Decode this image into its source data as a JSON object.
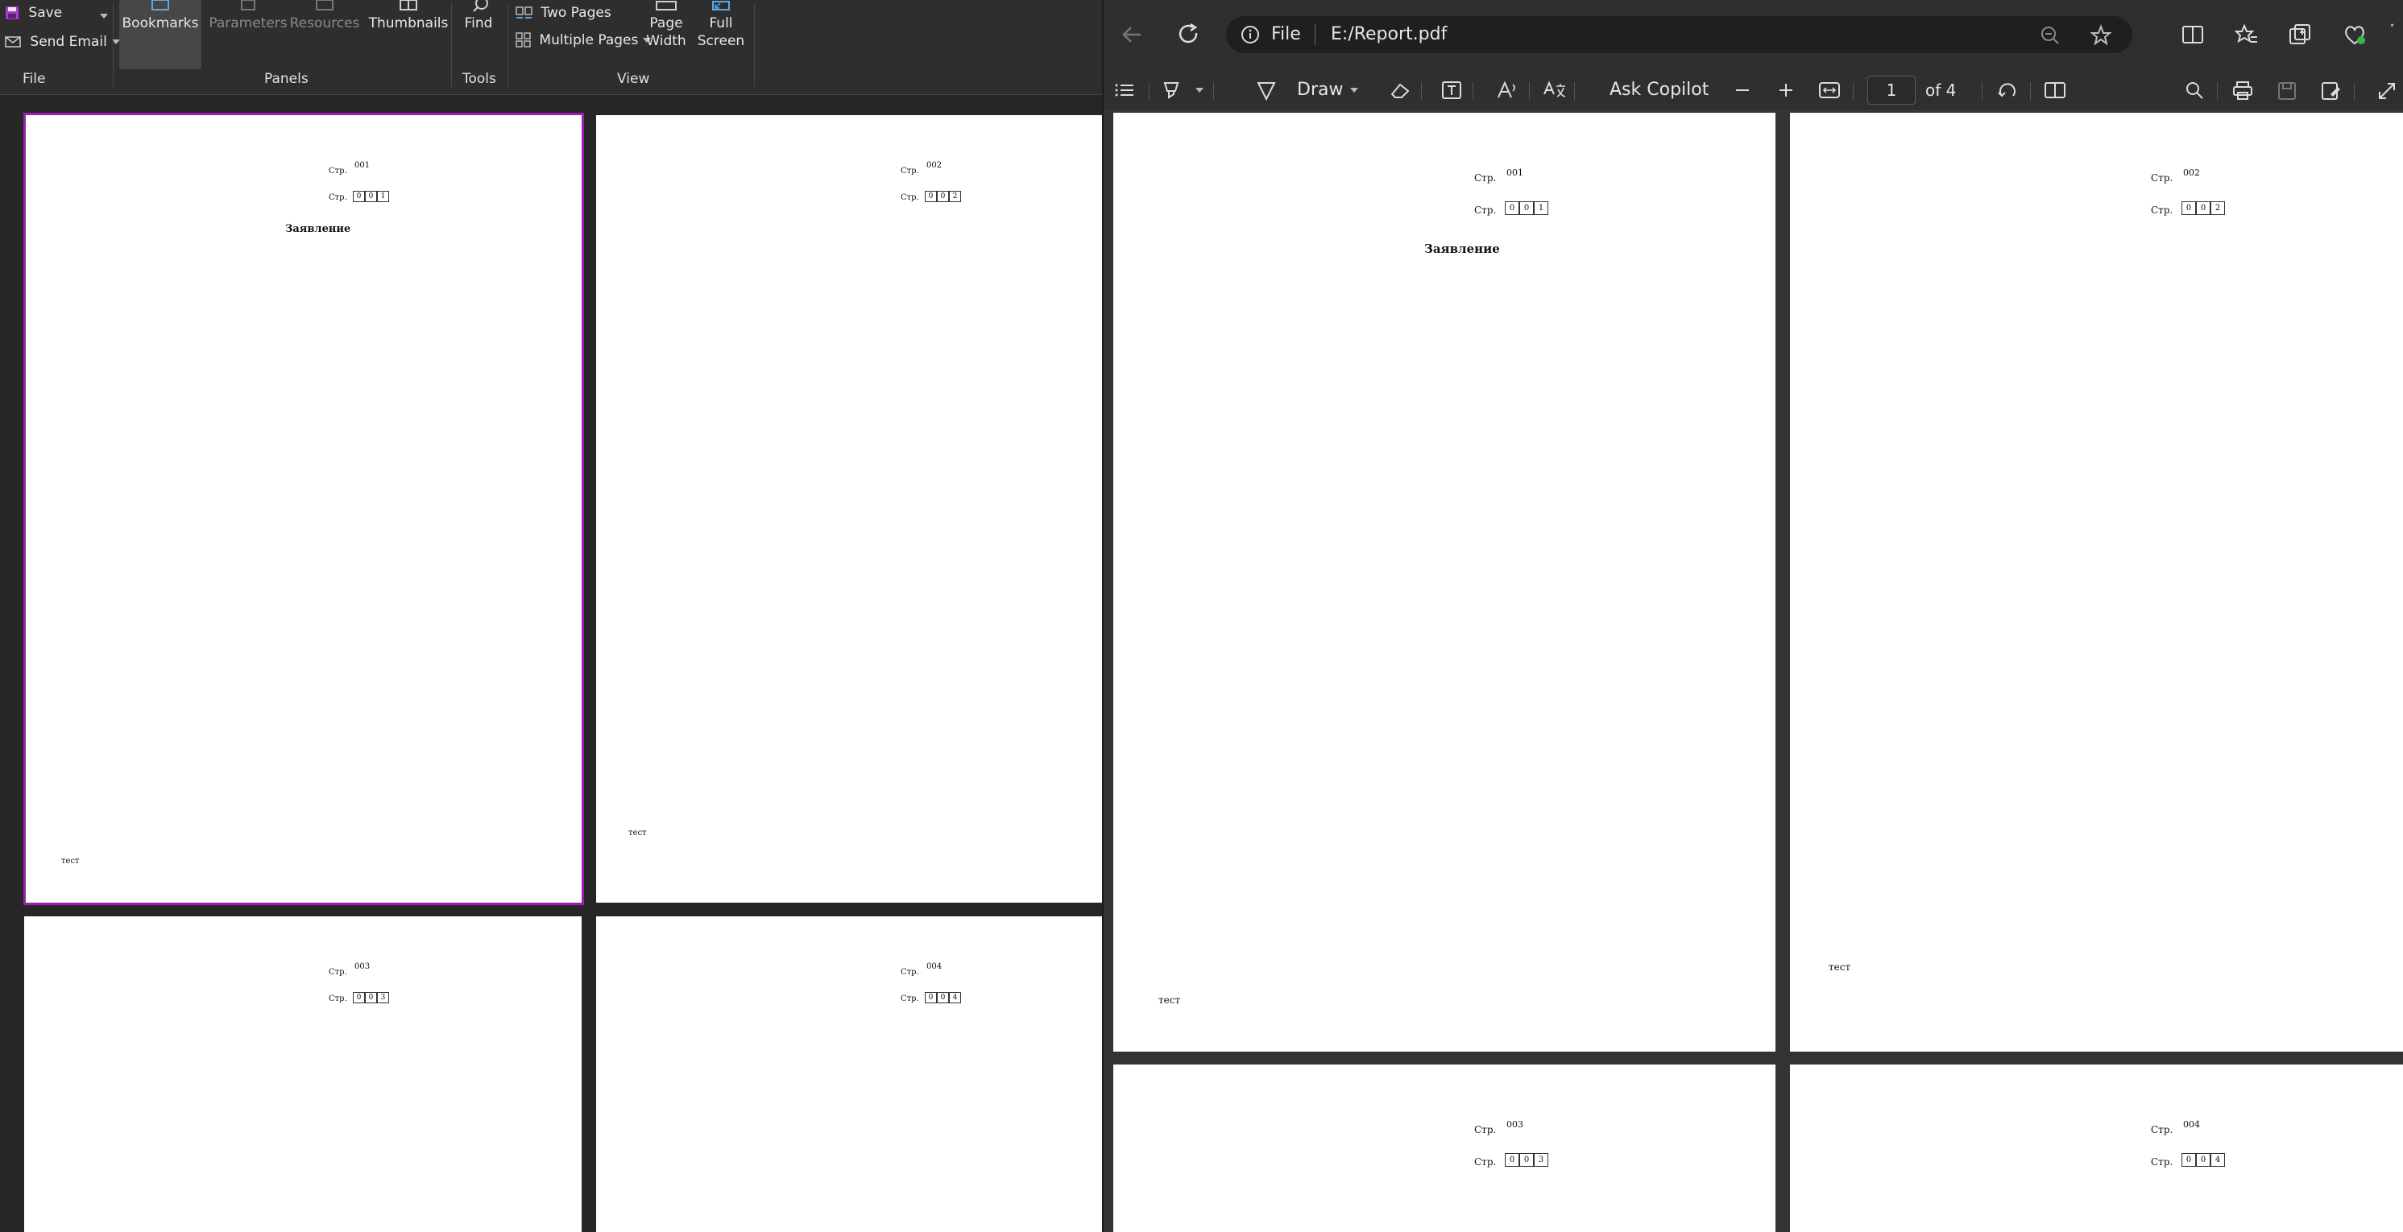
{
  "viewer": {
    "ribbon": {
      "save_label": "Save",
      "send_email_label": "Send Email",
      "bookmarks_label": "Bookmarks",
      "parameters_label": "Parameters",
      "resources_label": "Resources",
      "thumbnails_label": "Thumbnails",
      "find_label": "Find",
      "two_pages_label": "Two Pages",
      "multiple_pages_label": "Multiple Pages",
      "page_width_label_1": "Page",
      "page_width_label_2": "Width",
      "full_screen_label_1": "Full",
      "full_screen_label_2": "Screen",
      "groups": {
        "file": "File",
        "panels": "Panels",
        "tools": "Tools",
        "view": "View"
      }
    },
    "accent_color": "#9b1fb0"
  },
  "document": {
    "page_label": "Стр.",
    "title": "Заявление",
    "footer_text": "тест",
    "pages": [
      {
        "number": "001",
        "digits": [
          "0",
          "0",
          "1"
        ]
      },
      {
        "number": "002",
        "digits": [
          "0",
          "0",
          "2"
        ]
      },
      {
        "number": "003",
        "digits": [
          "0",
          "0",
          "3"
        ]
      },
      {
        "number": "004",
        "digits": [
          "0",
          "0",
          "4"
        ]
      }
    ]
  },
  "browser": {
    "address": {
      "scheme_label": "File",
      "url": "E:/Report.pdf"
    },
    "pdf_toolbar": {
      "draw_label": "Draw",
      "ask_copilot_label": "Ask Copilot",
      "current_page": "1",
      "page_total_label": "of 4"
    }
  }
}
